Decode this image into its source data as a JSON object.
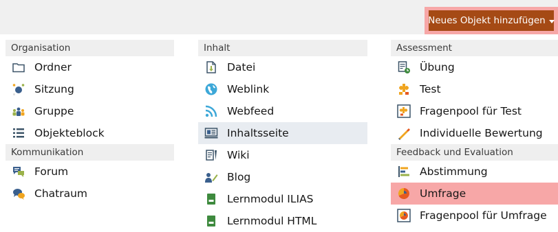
{
  "header": {
    "add_object_label": "Neues Objekt hinzufügen"
  },
  "columns": [
    {
      "groups": [
        {
          "title": "Organisation",
          "items": [
            {
              "label": "Ordner",
              "icon": "folder-icon"
            },
            {
              "label": "Sitzung",
              "icon": "session-icon"
            },
            {
              "label": "Gruppe",
              "icon": "group-icon"
            },
            {
              "label": "Objekteblock",
              "icon": "item-block-icon"
            }
          ]
        },
        {
          "title": "Kommunikation",
          "items": [
            {
              "label": "Forum",
              "icon": "forum-icon"
            },
            {
              "label": "Chatraum",
              "icon": "chatroom-icon"
            }
          ]
        }
      ]
    },
    {
      "groups": [
        {
          "title": "Inhalt",
          "items": [
            {
              "label": "Datei",
              "icon": "file-icon"
            },
            {
              "label": "Weblink",
              "icon": "weblink-icon"
            },
            {
              "label": "Webfeed",
              "icon": "webfeed-icon"
            },
            {
              "label": "Inhaltsseite",
              "icon": "content-page-icon",
              "state": "selected"
            },
            {
              "label": "Wiki",
              "icon": "wiki-icon"
            },
            {
              "label": "Blog",
              "icon": "blog-icon"
            },
            {
              "label": "Lernmodul ILIAS",
              "icon": "learning-module-ilias-icon"
            },
            {
              "label": "Lernmodul HTML",
              "icon": "learning-module-html-icon"
            }
          ]
        }
      ]
    },
    {
      "groups": [
        {
          "title": "Assessment",
          "items": [
            {
              "label": "Übung",
              "icon": "exercise-icon"
            },
            {
              "label": "Test",
              "icon": "test-icon"
            },
            {
              "label": "Fragenpool für Test",
              "icon": "question-pool-test-icon"
            },
            {
              "label": "Individuelle Bewertung",
              "icon": "individual-assessment-icon"
            }
          ]
        },
        {
          "title": "Feedback und Evaluation",
          "items": [
            {
              "label": "Abstimmung",
              "icon": "poll-icon"
            },
            {
              "label": "Umfrage",
              "icon": "survey-icon",
              "state": "highlighted"
            },
            {
              "label": "Fragenpool für Umfrage",
              "icon": "question-pool-survey-icon"
            }
          ]
        }
      ]
    }
  ],
  "colors": {
    "button_bg": "#a54a15",
    "highlight": "#f7a7a7",
    "selected_row": "#e8ecf1",
    "header_bg": "#efefef"
  }
}
